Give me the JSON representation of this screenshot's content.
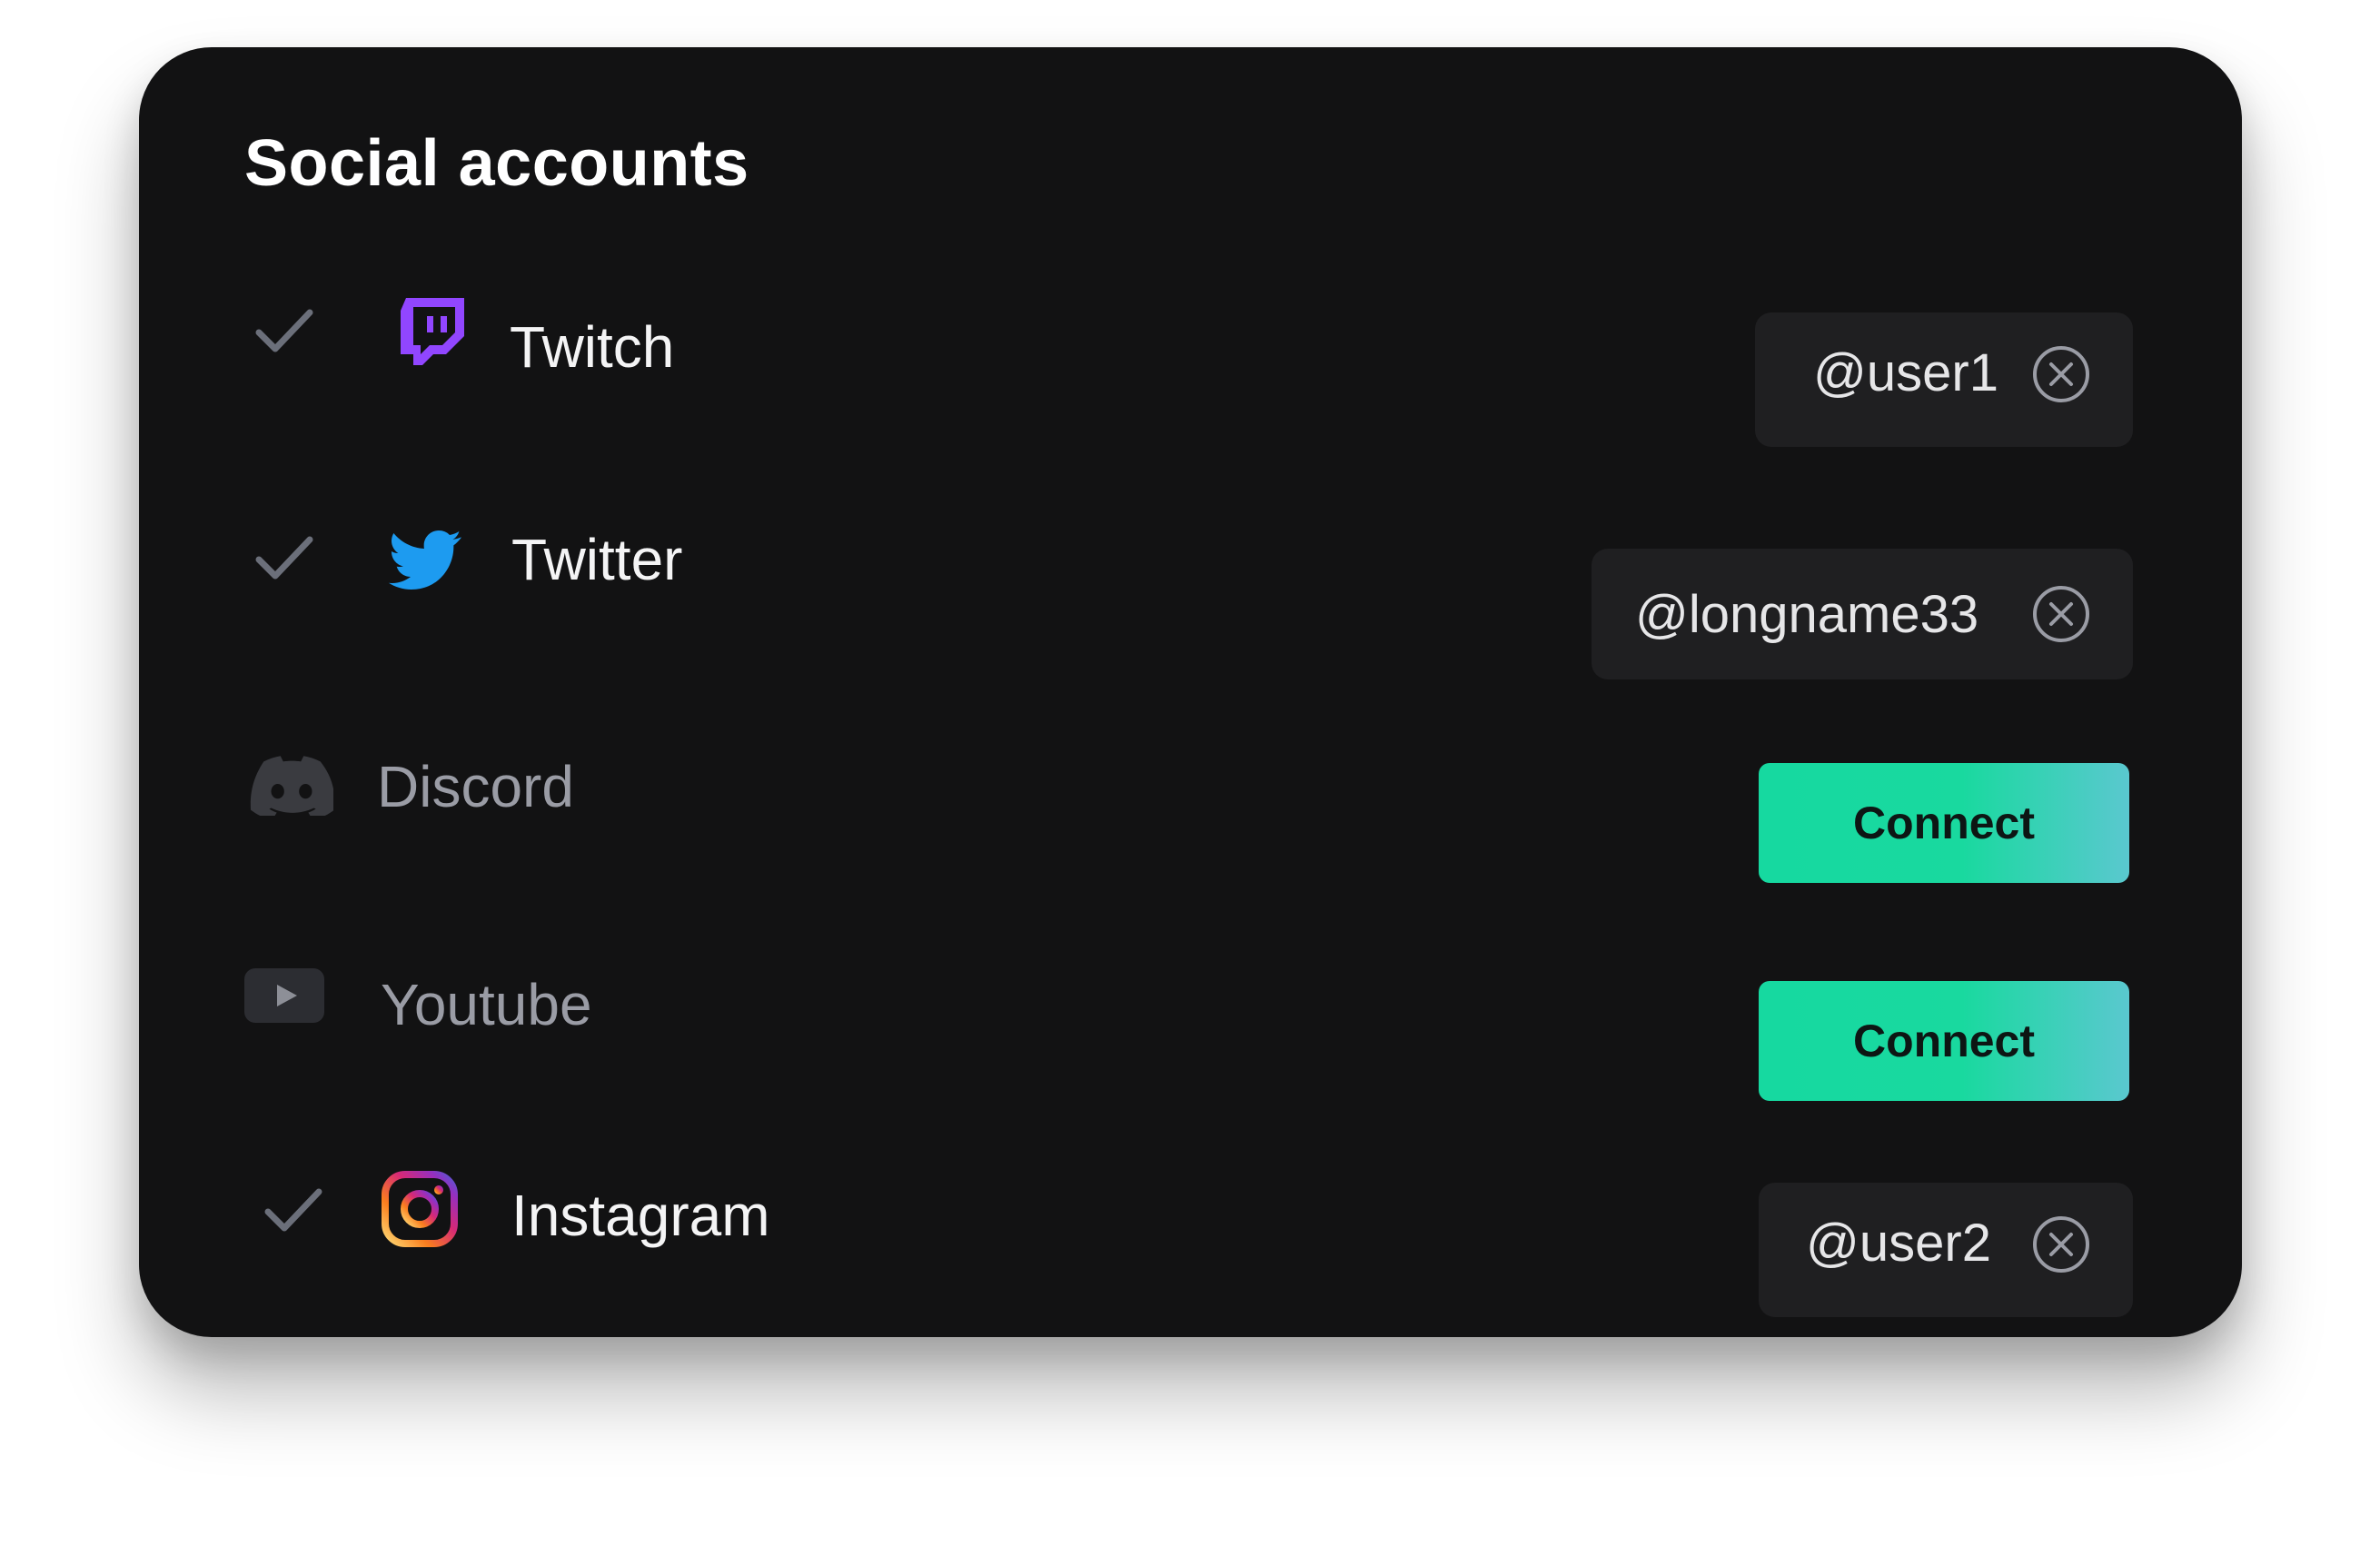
{
  "panel": {
    "title": "Social accounts"
  },
  "accounts": [
    {
      "name": "Twitch",
      "icon": "twitch-icon",
      "connected": true,
      "handle": "@user1",
      "brand_color": "#9146ff"
    },
    {
      "name": "Twitter",
      "icon": "twitter-icon",
      "connected": true,
      "handle": "@longname33",
      "brand_color": "#1d9bf0"
    },
    {
      "name": "Discord",
      "icon": "discord-icon",
      "connected": false,
      "action_label": "Connect"
    },
    {
      "name": "Youtube",
      "icon": "youtube-icon",
      "connected": false,
      "action_label": "Connect"
    },
    {
      "name": "Instagram",
      "icon": "instagram-icon",
      "connected": true,
      "handle": "@user2"
    }
  ],
  "colors": {
    "card_background": "#121213",
    "handle_pill": "#1f1f21",
    "connect_gradient_start": "#16d9a0",
    "connect_gradient_end": "#5ac8cf",
    "check": "#6b6f7a"
  }
}
